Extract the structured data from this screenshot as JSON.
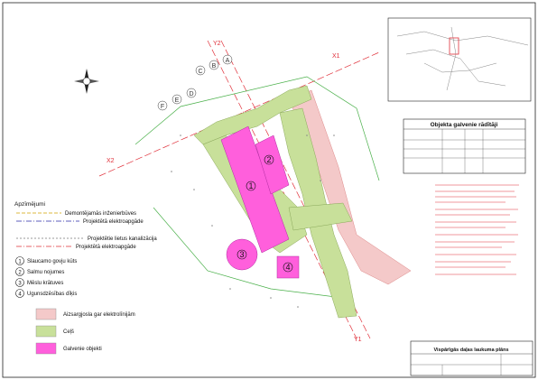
{
  "legend": {
    "title": "Apzīmējumi",
    "lines": [
      {
        "label": "Demontējamās inženierbūves"
      },
      {
        "label": "Projektētā elektroapgāde"
      },
      {
        "label": "Projektētie lietus kanalizācija"
      },
      {
        "label": "Projektētā elektroapgāde"
      }
    ],
    "objects": [
      {
        "num": "1",
        "label": "Slaucamo govju kūts"
      },
      {
        "num": "2",
        "label": "Salmu nojumes"
      },
      {
        "num": "3",
        "label": "Mēslu krātuves"
      },
      {
        "num": "4",
        "label": "Ugunsdzēsības dīķis"
      }
    ],
    "areas": [
      {
        "label": "Aizsargjosla gar elektrolīnijām",
        "color": "#f4c9c9"
      },
      {
        "label": "Ceļš",
        "color": "#c8e09a"
      },
      {
        "label": "Galvenie objekti",
        "color": "#ff5fdc"
      }
    ]
  },
  "indicators": {
    "title": "Objekta galvenie rādītāji"
  },
  "title_block": {
    "title": "Vispārīgās daļas laukuma plāns"
  },
  "plan_labels": {
    "buildings": [
      "1",
      "2",
      "3",
      "4"
    ],
    "axes": [
      "X2",
      "X1",
      "Y2",
      "Y1"
    ],
    "grid_letters": [
      "F",
      "E",
      "D",
      "C",
      "B",
      "A"
    ]
  },
  "colors": {
    "main_objects": "#ff5fdc",
    "road": "#c8e09a",
    "protection_zone": "#f4c9c9",
    "axis_red": "#e0303a",
    "green_line": "#4ab04a"
  }
}
